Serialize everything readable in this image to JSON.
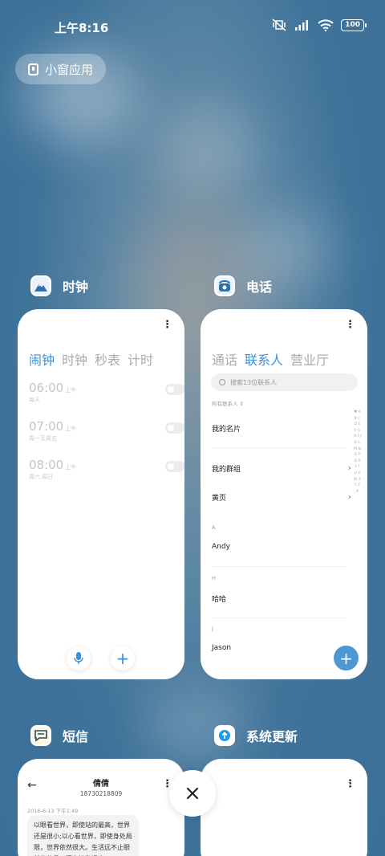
{
  "status_bar": {
    "time": "上午8:16",
    "battery": "100"
  },
  "small_window": {
    "label": "小窗应用"
  },
  "apps": {
    "clock": {
      "title": "时钟",
      "tabs": [
        "闹钟",
        "时钟",
        "秒表",
        "计时"
      ],
      "alarms": [
        {
          "time": "06:00",
          "ampm": "上午",
          "repeat": "每天"
        },
        {
          "time": "07:00",
          "ampm": "上午",
          "repeat": "周一至周五"
        },
        {
          "time": "08:00",
          "ampm": "上午",
          "repeat": "周六 周日"
        }
      ]
    },
    "phone": {
      "title": "电话",
      "tabs": [
        "通话",
        "联系人",
        "营业厅"
      ],
      "search_placeholder": "搜索13位联系人",
      "section_all": "所有联系人",
      "my_card": "我的名片",
      "my_groups": "我的群组",
      "yellow_pages": "黄页",
      "contacts": [
        {
          "letter": "A",
          "name": "Andy"
        },
        {
          "letter": "H",
          "name": "哈哈"
        },
        {
          "letter": "J",
          "name": "Jason"
        }
      ],
      "alphabet": "♥ A B C D E F G H I J K L M N O P Q R S T U V W X Y Z #"
    },
    "sms": {
      "title": "短信",
      "contact_name": "倩倩",
      "contact_number": "18730218809",
      "date": "2016-6-13 下午1:49",
      "message": "以眼看世界，即使站的最高，世界还是很小;以心看世界，即使身处局限，世界依然很大。生活远不止眼前的苟且，还有诗和远方。"
    },
    "update": {
      "title": "系统更新"
    }
  }
}
